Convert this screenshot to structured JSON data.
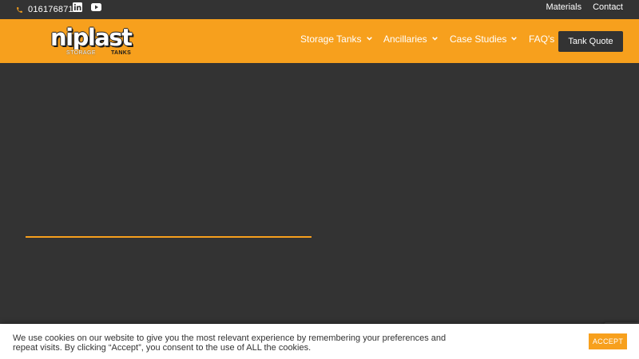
{
  "topbar": {
    "phone": "01617687118",
    "phone_icon": "phone-icon",
    "social": [
      {
        "icon": "linkedin-icon"
      },
      {
        "icon": "youtube-icon"
      }
    ],
    "links": [
      "Materials",
      "Contact"
    ]
  },
  "brand": {
    "logo_word": "niplast",
    "logo_sub": "STORAGE",
    "logo_sub_bold": "TANKS"
  },
  "nav": {
    "items": [
      {
        "label": "Storage Tanks",
        "has_dropdown": true
      },
      {
        "label": "Ancillaries",
        "has_dropdown": true
      },
      {
        "label": "Case Studies",
        "has_dropdown": true
      },
      {
        "label": "FAQ's",
        "has_dropdown": false
      }
    ],
    "cta": "Tank Quote"
  },
  "cookie": {
    "text": "We use cookies on our website to give you the most relevant experience by remembering your preferences and repeat visits. By clicking “Accept”, you consent to the use of ALL the cookies.",
    "accept": "ACCEPT"
  },
  "colors": {
    "accent": "#f7a01d",
    "dark": "#333333",
    "white": "#ffffff"
  }
}
